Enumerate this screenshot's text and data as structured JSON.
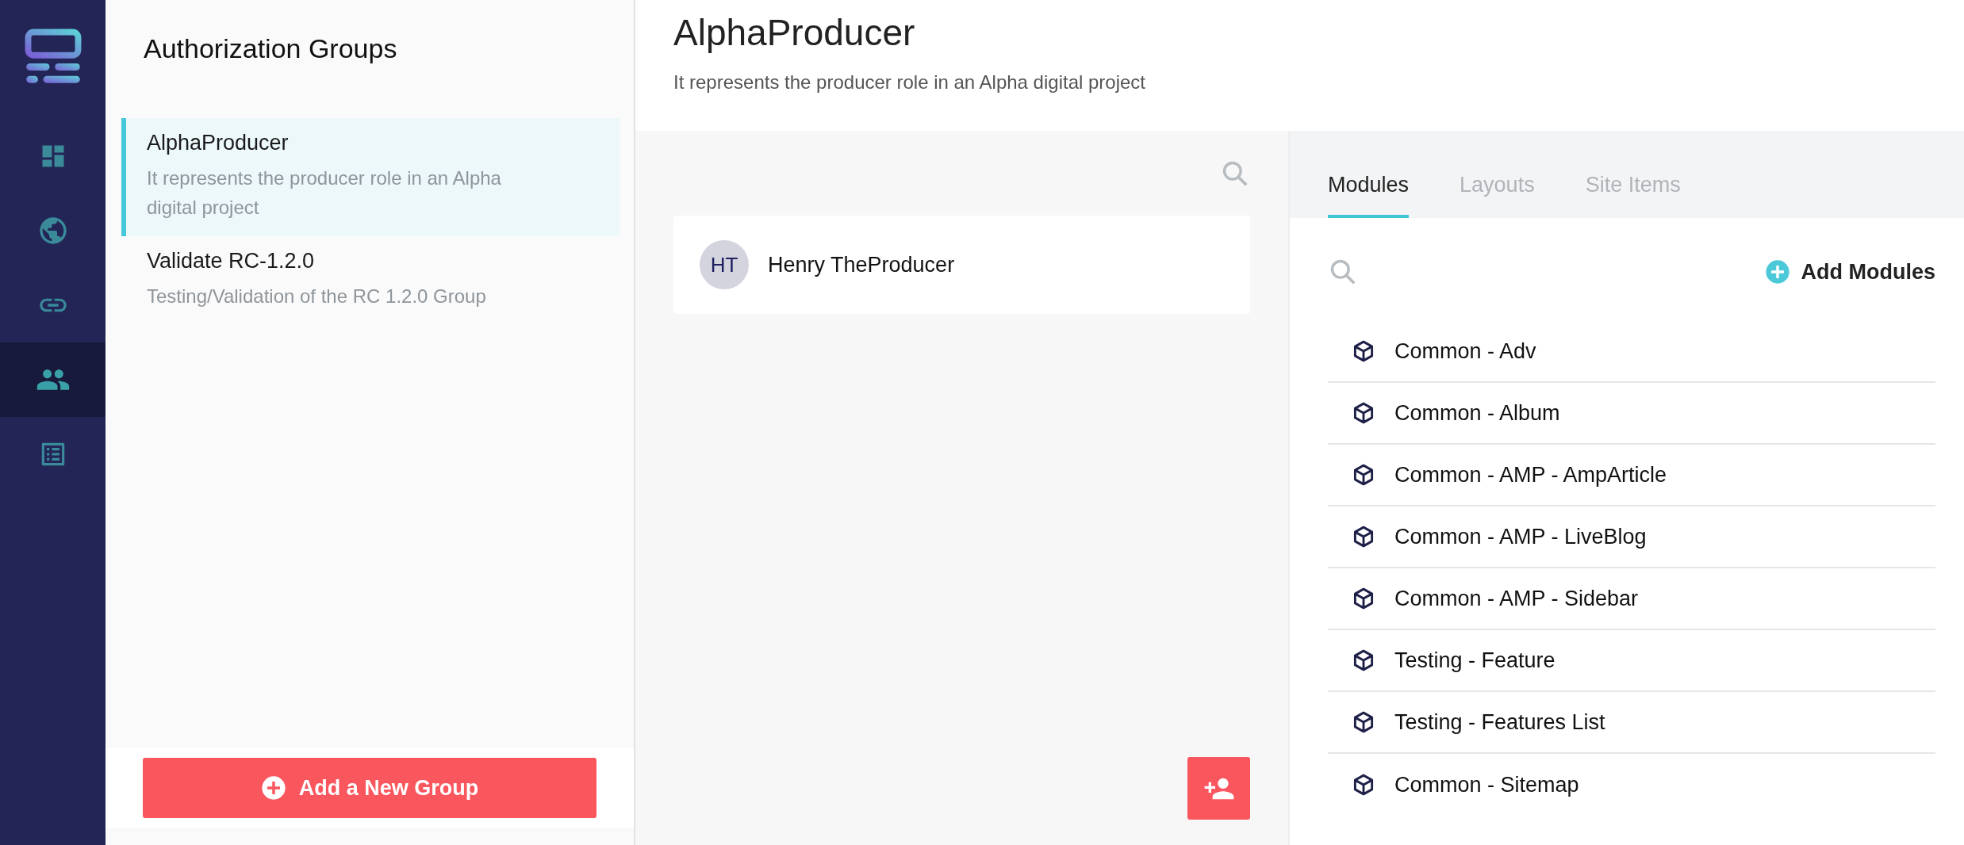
{
  "nav": [
    {
      "kind": "dashboard",
      "selected": false
    },
    {
      "kind": "globe",
      "selected": false
    },
    {
      "kind": "link",
      "selected": false
    },
    {
      "kind": "people",
      "selected": true
    },
    {
      "kind": "list",
      "selected": false
    }
  ],
  "groups_panel": {
    "title": "Authorization Groups",
    "groups": [
      {
        "name": "AlphaProducer",
        "description": "It represents the producer role in an Alpha digital project",
        "selected": true
      },
      {
        "name": "Validate RC-1.2.0",
        "description": "Testing/Validation of the RC 1.2.0 Group",
        "selected": false
      }
    ],
    "add_button": "Add a New Group"
  },
  "header": {
    "title": "AlphaProducer",
    "description": "It represents the producer role in an Alpha digital project"
  },
  "users": [
    {
      "initials": "HT",
      "name": "Henry TheProducer"
    }
  ],
  "tabs": [
    {
      "label": "Modules",
      "selected": true
    },
    {
      "label": "Layouts",
      "selected": false
    },
    {
      "label": "Site Items",
      "selected": false
    }
  ],
  "add_modules_button": "Add Modules",
  "modules": [
    "Common - Adv",
    "Common - Album",
    "Common - AMP - AmpArticle",
    "Common - AMP - LiveBlog",
    "Common - AMP - Sidebar",
    "Testing - Feature",
    "Testing - Features List",
    "Common - Sitemap"
  ]
}
